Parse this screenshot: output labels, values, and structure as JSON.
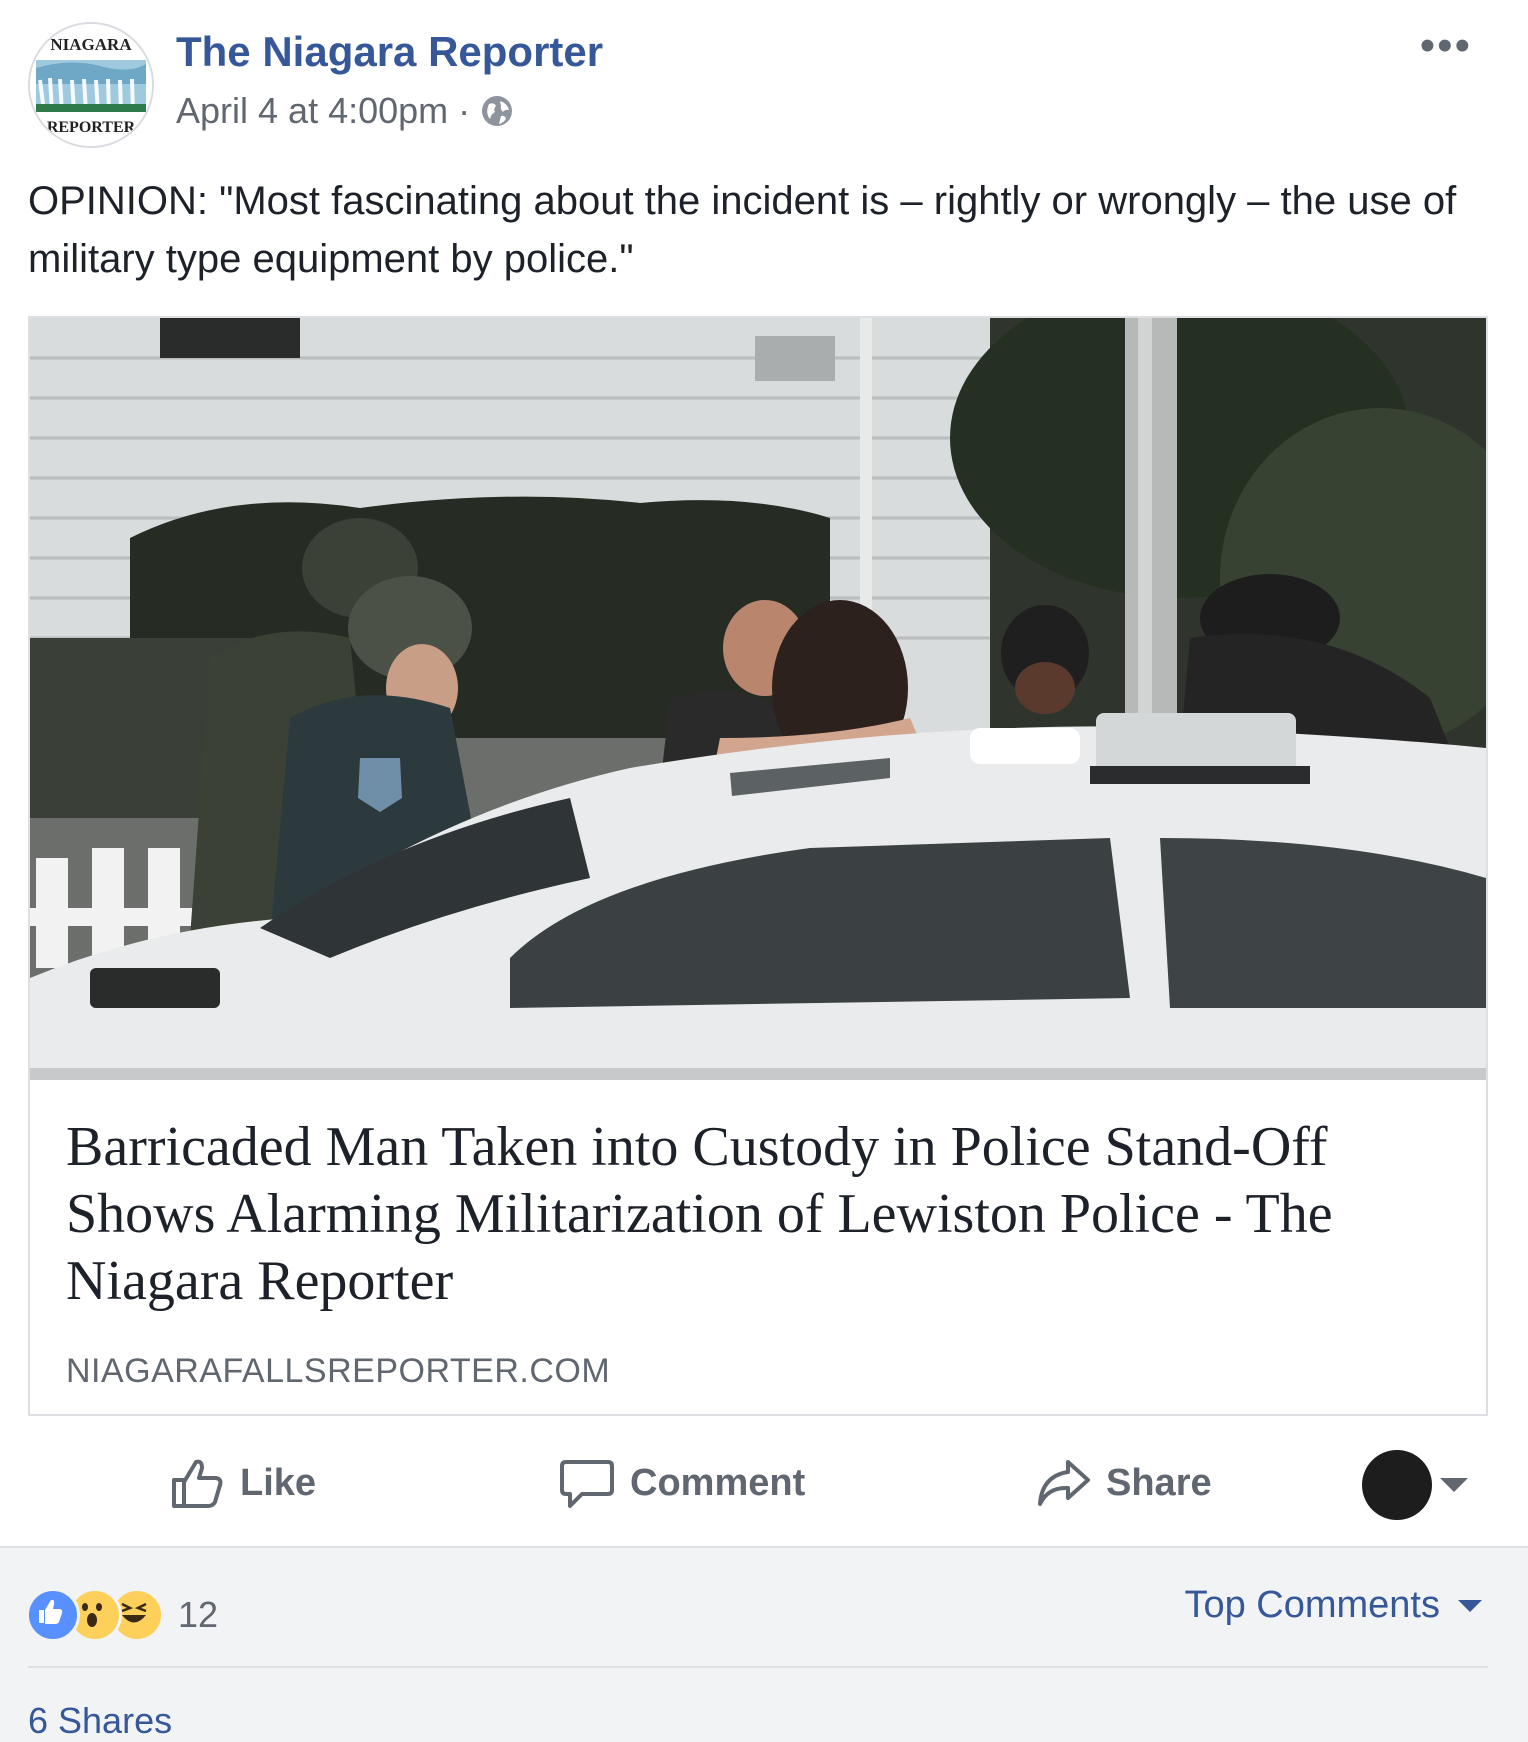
{
  "header": {
    "logo_text_top": "NIAGARA",
    "logo_text_bottom": "REPORTER",
    "page_name": "The Niagara Reporter",
    "timestamp": "April 4 at 4:00pm",
    "separator": "·",
    "privacy_icon": "globe-icon",
    "more_label": "•••"
  },
  "post": {
    "text": "OPINION: \"Most fascinating about the incident is – rightly or wrongly – the use of military type equipment by police.\""
  },
  "link_card": {
    "title": "Barricaded Man Taken into Custody in Police Stand-Off Shows Alarming Militarization of Lewiston Police - The Niagara Reporter",
    "domain": "NIAGARAFALLSREPORTER.COM"
  },
  "actions": {
    "like_label": "Like",
    "comment_label": "Comment",
    "share_label": "Share",
    "like_icon": "thumbs-up-icon",
    "comment_icon": "speech-bubble-icon",
    "share_icon": "share-arrow-icon",
    "audience_icon": "chevron-down-icon"
  },
  "footer": {
    "reaction_icons": [
      "like-reaction-icon",
      "wow-reaction-icon",
      "haha-reaction-icon"
    ],
    "reaction_count": "12",
    "top_comments_label": "Top Comments",
    "shares_label": "6 Shares"
  },
  "colors": {
    "link_blue": "#365899",
    "text_gray": "#606770",
    "footer_bg": "#f2f3f5",
    "like_blue": "#5890ff",
    "emoji_yellow": "#fcd05a"
  }
}
